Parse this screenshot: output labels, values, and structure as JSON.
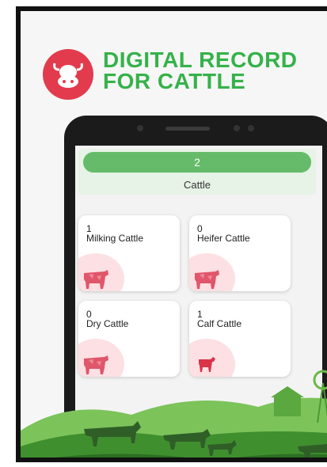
{
  "brand": {
    "line1": "DIGITAL RECORD",
    "line2": "FOR CATTLE",
    "accent": "#35b24a",
    "logo_color": "#e23b4d"
  },
  "summary": {
    "count": "2",
    "label": "Cattle"
  },
  "categories": [
    {
      "count": "1",
      "label": "Milking Cattle",
      "icon": "cow-icon"
    },
    {
      "count": "0",
      "label": "Heifer Cattle",
      "icon": "cow-icon"
    },
    {
      "count": "0",
      "label": "Dry Cattle",
      "icon": "cow-icon"
    },
    {
      "count": "1",
      "label": "Calf Cattle",
      "icon": "calf-icon"
    }
  ]
}
